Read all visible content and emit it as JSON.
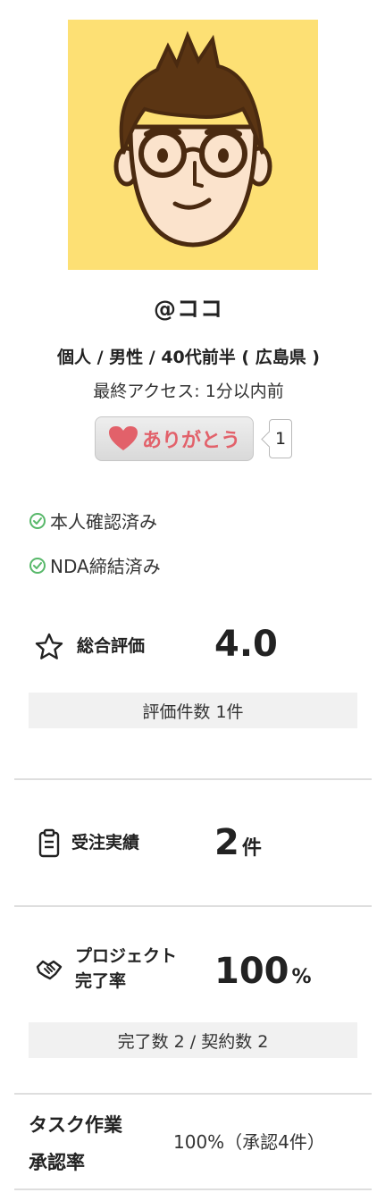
{
  "profile": {
    "username": "@ココ",
    "attributes": "個人 / 男性 / 40代前半 ( 広島県 )",
    "last_access": "最終アクセス: 1分以内前",
    "avatar_bg_color": "#fde074"
  },
  "thanks": {
    "label": "ありがとう",
    "count": "1",
    "heart_color": "#e2616a"
  },
  "verification": {
    "identity": "本人確認済み",
    "nda": "NDA締結済み",
    "check_color": "#58b86a"
  },
  "rating": {
    "label": "総合評価",
    "value": "4.0",
    "count_text": "評価件数 1件"
  },
  "orders": {
    "label": "受注実績",
    "value": "2",
    "unit": "件"
  },
  "completion": {
    "label_line1": "プロジェクト",
    "label_line2": "完了率",
    "value": "100",
    "unit": "%",
    "detail": "完了数 2 / 契約数 2"
  },
  "task_approval": {
    "label_line1": "タスク作業",
    "label_line2": "承認率",
    "value": "100%（承認4件）"
  }
}
